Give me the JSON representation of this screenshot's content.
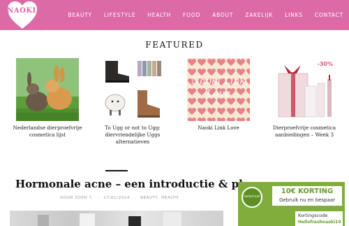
{
  "header": {
    "logo_text": "NAOKI",
    "nav": [
      "BEAUTY",
      "LIFESTYLE",
      "HEALTH",
      "FOOD",
      "ABOUT",
      "ZAKELIJK",
      "LINKS",
      "CONTACT"
    ]
  },
  "featured": {
    "title": "FEATURED",
    "items": [
      {
        "caption": "Nederlandse dierproefvrije cosmetica lijst"
      },
      {
        "caption": "To Ugg or not to Ugg: diervriendelijke Uggs alternatieven"
      },
      {
        "caption": "Naoki Link Love",
        "image_text": "Naoki Link Love"
      },
      {
        "caption": "Dierproefvrije cosmetica aanbiedingen – Week 3",
        "image_text": "-30%"
      }
    ]
  },
  "post": {
    "title": "Hormonale acne – een introductie & plan",
    "author": "DOOR SOPH T.",
    "date": "17/01/2014",
    "categories": "BEAUTY, HEALTH"
  },
  "ad": {
    "badge": "HelloFresh",
    "headline": "10€ KORTING",
    "sub": "Gebruik nu en bespaar",
    "code_label": "Kortingscode",
    "code_value": "Hellofreshnaoki10"
  },
  "colors": {
    "header_pink": "#dc6aa6",
    "ad_green": "#7fae3c"
  }
}
